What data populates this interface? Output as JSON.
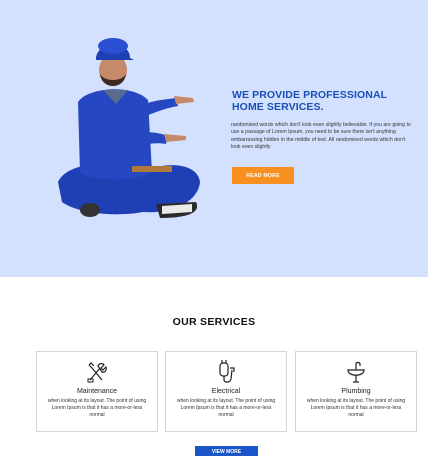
{
  "hero": {
    "title_line1": "WE PROVIDE PROFESSIONAL",
    "title_line2": "HOME SERVICES.",
    "body": "randomised words which don't look even slightly believable. If you are going to use a passage of Lorem Ipsum, you need to be sure there isn't anything embarrassing hidden in the middle of text. All randomised words which don't look even slightly",
    "button_label": "READ MORE",
    "accent_color": "#1a4fb8",
    "button_color": "#f7901e"
  },
  "services": {
    "title": "OUR SERVICES",
    "items": [
      {
        "name": "Maintenance",
        "icon": "tools-icon",
        "desc": "when looking at its layout. The point of using Lorem Ipsum is that it has a more-or-less normal"
      },
      {
        "name": "Electrical",
        "icon": "plug-icon",
        "desc": "when looking at its layout. The point of using Lorem Ipsum is that it has a more-or-less normal"
      },
      {
        "name": "Plumbing",
        "icon": "sink-icon",
        "desc": "when looking at its layout. The point of using Lorem Ipsum is that it has a more-or-less normal"
      }
    ],
    "button_label": "VIEW MORE",
    "button_color": "#1a56c8"
  }
}
